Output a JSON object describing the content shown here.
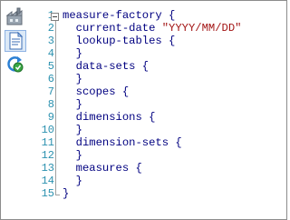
{
  "toolbar": {
    "tools": [
      {
        "name": "design-view-tool",
        "icon": "factory-icon",
        "active": false
      },
      {
        "name": "source-view-tool",
        "icon": "document-icon",
        "active": true
      },
      {
        "name": "refresh-tool",
        "icon": "refresh-icon",
        "active": false
      }
    ]
  },
  "editor": {
    "line_numbers": [
      "1",
      "2",
      "3",
      "4",
      "5",
      "6",
      "7",
      "8",
      "9",
      "10",
      "11",
      "12",
      "13",
      "14",
      "15"
    ],
    "lines": [
      {
        "text": "measure-factory {"
      },
      {
        "key": "current-date ",
        "value": "\"YYYY/MM/DD\""
      },
      {
        "text": "lookup-tables {"
      },
      {
        "text": "}"
      },
      {
        "text": "data-sets {"
      },
      {
        "text": "}"
      },
      {
        "text": "scopes {"
      },
      {
        "text": "}"
      },
      {
        "text": "dimensions {"
      },
      {
        "text": "}"
      },
      {
        "text": "dimension-sets {"
      },
      {
        "text": "}"
      },
      {
        "text": "measures {"
      },
      {
        "text": "}"
      },
      {
        "text": "}"
      }
    ]
  },
  "colors": {
    "keyword": "#000080",
    "string": "#a31515",
    "line_number": "#2b91af",
    "active_tool_bg": "#dce9f7"
  }
}
